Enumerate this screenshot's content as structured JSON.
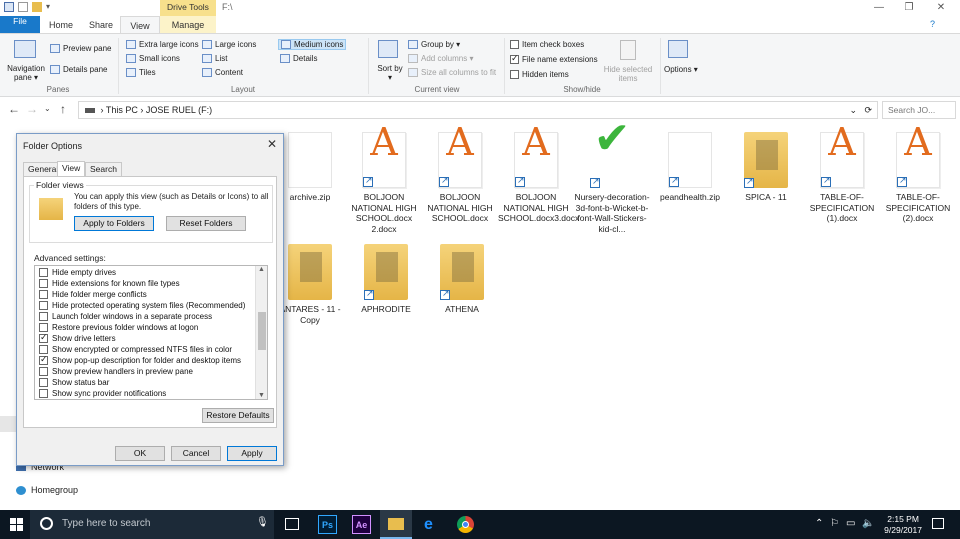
{
  "window": {
    "title": "F:\\",
    "drive_tools_label": "Drive Tools"
  },
  "tabs": [
    {
      "label": "File"
    },
    {
      "label": "Home"
    },
    {
      "label": "Share"
    },
    {
      "label": "View"
    },
    {
      "label": "Manage"
    }
  ],
  "ribbon": {
    "panes": {
      "group_label": "Panes",
      "navigation_pane": "Navigation pane ▾",
      "preview_pane": "Preview pane",
      "details_pane": "Details pane"
    },
    "layout": {
      "group_label": "Layout",
      "extra_large_icons": "Extra large icons",
      "large_icons": "Large icons",
      "medium_icons": "Medium icons",
      "small_icons": "Small icons",
      "list": "List",
      "details": "Details",
      "tiles": "Tiles",
      "content": "Content"
    },
    "current_view": {
      "group_label": "Current view",
      "sort_by": "Sort by ▾",
      "group_by": "Group by ▾",
      "add_columns": "Add columns ▾",
      "size_all_columns": "Size all columns to fit"
    },
    "show_hide": {
      "group_label": "Show/hide",
      "item_check_boxes": "Item check boxes",
      "file_name_extensions": "File name extensions",
      "hidden_items": "Hidden items",
      "hide_selected_items": "Hide selected items",
      "item_check_boxes_checked": false,
      "file_name_extensions_checked": true,
      "hidden_items_checked": false
    },
    "options": "Options ▾"
  },
  "address": {
    "breadcrumb_this_pc": "This PC",
    "breadcrumb_drive": "JOSE RUEL (F:)",
    "search_placeholder": "Search JO..."
  },
  "leftnav": {
    "network": "Network",
    "homegroup": "Homegroup"
  },
  "files": [
    {
      "name": "archive.zip"
    },
    {
      "name": "BOLJOON NATIONAL HIGH SCHOOL.docx 2.docx"
    },
    {
      "name": "BOLJOON NATIONAL HIGH SCHOOL.docx"
    },
    {
      "name": "BOLJOON NATIONAL HIGH SCHOOL.docx3.docx"
    },
    {
      "name": "Nursery-decoration-3d-font-b-Wicket-b-font-Wall-Stickers-kid-cl..."
    },
    {
      "name": "peandhealth.zip"
    },
    {
      "name": "SPICA - 11"
    },
    {
      "name": "TABLE-OF-SPECIFICATION (1).docx"
    },
    {
      "name": "TABLE-OF-SPECIFICATION (2).docx"
    },
    {
      "name": "ANTARES - 11 - Copy"
    },
    {
      "name": "APHRODITE"
    },
    {
      "name": "ATHENA"
    }
  ],
  "dialog": {
    "title": "Folder Options",
    "tabs": [
      "General",
      "View",
      "Search"
    ],
    "folder_views_legend": "Folder views",
    "folder_views_text": "You can apply this view (such as Details or Icons) to all folders of this type.",
    "apply_to_folders": "Apply to Folders",
    "reset_folders": "Reset Folders",
    "advanced_label": "Advanced settings:",
    "advanced_items": [
      {
        "label": "Hide empty drives",
        "checked": false
      },
      {
        "label": "Hide extensions for known file types",
        "checked": false
      },
      {
        "label": "Hide folder merge conflicts",
        "checked": false
      },
      {
        "label": "Hide protected operating system files (Recommended)",
        "checked": false
      },
      {
        "label": "Launch folder windows in a separate process",
        "checked": false
      },
      {
        "label": "Restore previous folder windows at logon",
        "checked": false
      },
      {
        "label": "Show drive letters",
        "checked": true
      },
      {
        "label": "Show encrypted or compressed NTFS files in color",
        "checked": false
      },
      {
        "label": "Show pop-up description for folder and desktop items",
        "checked": true
      },
      {
        "label": "Show preview handlers in preview pane",
        "checked": false
      },
      {
        "label": "Show status bar",
        "checked": false
      },
      {
        "label": "Show sync provider notifications",
        "checked": false
      }
    ],
    "restore_defaults": "Restore Defaults",
    "ok": "OK",
    "cancel": "Cancel",
    "apply": "Apply"
  },
  "taskbar": {
    "search_placeholder": "Type here to search",
    "time": "2:15 PM",
    "date": "9/29/2017",
    "apps": [
      "Ps",
      "Ae"
    ]
  },
  "colors": {
    "accent": "#1979ca",
    "taskbar": "#0c1722",
    "drive_tools": "#f7e08c"
  }
}
